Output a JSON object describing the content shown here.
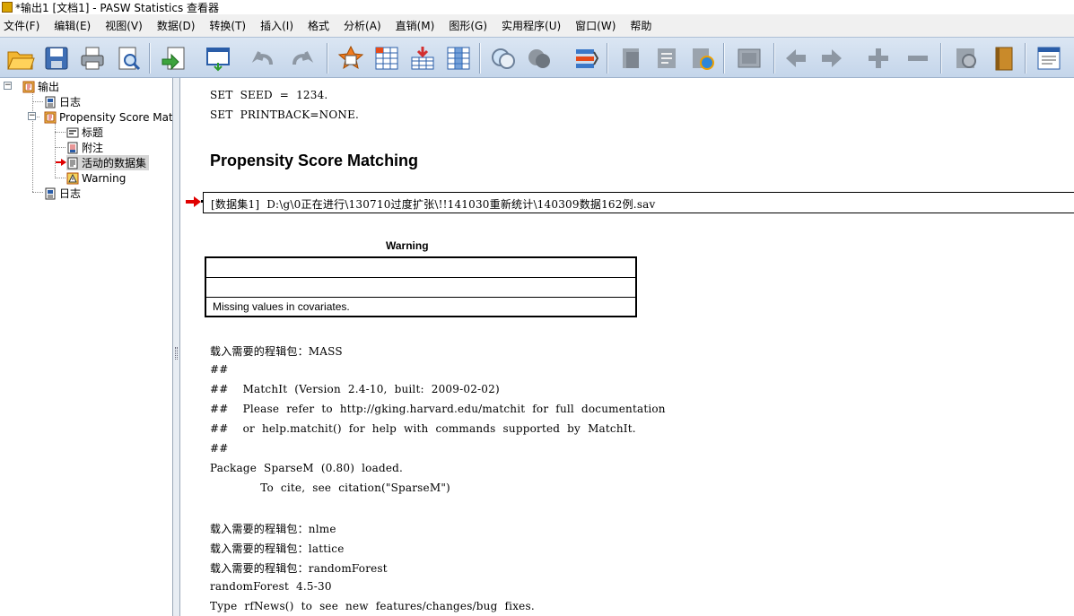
{
  "window": {
    "title": "*输出1 [文档1] - PASW Statistics 查看器"
  },
  "menubar": {
    "items": [
      "文件(F)",
      "编辑(E)",
      "视图(V)",
      "数据(D)",
      "转换(T)",
      "插入(I)",
      "格式",
      "分析(A)",
      "直销(M)",
      "图形(G)",
      "实用程序(U)",
      "窗口(W)",
      "帮助"
    ]
  },
  "toolbar": {
    "buttons": [
      "open-icon",
      "save-icon",
      "print-icon",
      "print-preview-icon",
      "export-icon",
      "recall-dialog-icon",
      "undo-icon",
      "redo-icon",
      "goto-data-icon",
      "goto-case-icon",
      "insert-cases-icon",
      "variables-icon",
      "select-cases-icon",
      "weight-cases-icon",
      "value-labels-icon",
      "use-variable-sets-icon",
      "insert-heading-icon",
      "insert-title-icon",
      "insert-text-icon",
      "designate-window-icon",
      "pivot-icon",
      "previous-icon",
      "next-icon",
      "expand-icon",
      "collapse-icon",
      "show-icon",
      "hide-icon",
      "script-icon"
    ]
  },
  "outline": {
    "root": "输出",
    "log1": "日志",
    "procedure": "Propensity Score Matcl",
    "title": "标题",
    "notes": "附注",
    "active_dataset": "活动的数据集",
    "warning": "Warning",
    "log2": "日志"
  },
  "content": {
    "syntax_lines": [
      "SET  SEED  =  1234.",
      "SET  PRINTBACK=NONE."
    ],
    "heading": "Propensity Score Matching",
    "dataset_line": "[数据集1]  D:\\g\\0正在进行\\130710过度扩张\\!!141030重新统计\\140309数据162例.sav",
    "warning_table": {
      "title": "Warning",
      "message": "Missing values in covariates."
    },
    "log_lines": [
      "载入需要的程辑包：MASS",
      "##",
      "##    MatchIt  (Version  2.4-10,  built:  2009-02-02)",
      "##    Please  refer  to  http://gking.harvard.edu/matchit  for  full  documentation",
      "##    or  help.matchit()  for  help  with  commands  supported  by  MatchIt.",
      "##",
      "Package  SparseM  (0.80)  loaded.",
      "              To  cite,  see  citation(\"SparseM\")",
      "",
      "载入需要的程辑包：nlme",
      "载入需要的程辑包：lattice",
      "载入需要的程辑包：randomForest",
      "randomForest  4.5-30",
      "Type  rfNews()  to  see  new  features/changes/bug  fixes."
    ]
  }
}
